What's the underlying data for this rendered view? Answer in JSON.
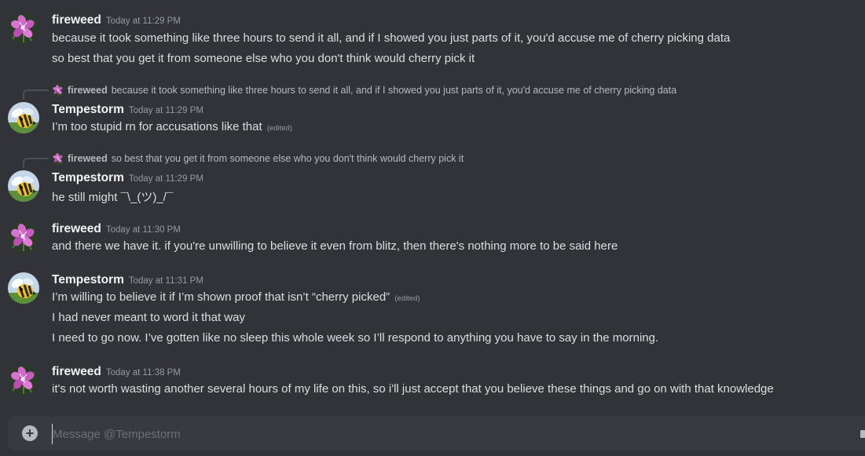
{
  "messages": [
    {
      "author": "fireweed",
      "timestamp": "Today at 11:29 PM",
      "avatar_icon": "fireweed-flower-icon",
      "lines": [
        {
          "text": "because it took something like three hours to send it all, and if I showed you just parts of it, you'd accuse me of cherry picking data"
        },
        {
          "text": "so best that you get it from someone else who you don't think would cherry pick it"
        }
      ]
    },
    {
      "author": "Tempestorm",
      "timestamp": "Today at 11:29 PM",
      "avatar_icon": "cartoon-bee-icon",
      "reply": {
        "author": "fireweed",
        "text": "because it took something like three hours to send it all, and if I showed you just parts of it, you'd accuse me of cherry picking data"
      },
      "lines": [
        {
          "text": "I’m too stupid rn for accusations like that",
          "edited": "(edited)"
        }
      ]
    },
    {
      "author": "Tempestorm",
      "timestamp": "Today at 11:29 PM",
      "avatar_icon": "cartoon-bee-icon",
      "reply": {
        "author": "fireweed",
        "text": "so best that you get it from someone else who you don't think would cherry pick it"
      },
      "lines": [
        {
          "text": "he still might ¯\\_(ツ)_/¯"
        }
      ]
    },
    {
      "author": "fireweed",
      "timestamp": "Today at 11:30 PM",
      "avatar_icon": "fireweed-flower-icon",
      "lines": [
        {
          "text": "and there we have it. if you're unwilling to believe it even from blitz, then there's nothing more to be said here"
        }
      ]
    },
    {
      "author": "Tempestorm",
      "timestamp": "Today at 11:31 PM",
      "avatar_icon": "cartoon-bee-icon",
      "lines": [
        {
          "text": "I’m willing to believe it if I’m shown proof that isn’t “cherry picked”",
          "edited": "(edited)"
        },
        {
          "text": "I had never meant to word it that way"
        },
        {
          "text": "I need to go now. I’ve gotten like no sleep this whole week so I’ll respond to anything you have to say in the morning."
        }
      ]
    },
    {
      "author": "fireweed",
      "timestamp": "Today at 11:38 PM",
      "avatar_icon": "fireweed-flower-icon",
      "lines": [
        {
          "text": "it's not worth wasting another several hours of my life on this, so i'll just accept that you believe these things and go on with that knowledge"
        }
      ]
    }
  ],
  "composer": {
    "placeholder": "Message @Tempestorm",
    "value": "",
    "attach_icon": "plus-circle-icon"
  },
  "colors": {
    "background": "#313338",
    "text": "#dbdee1",
    "muted": "#949ba4",
    "username": "#f2f3f5",
    "composer_bg": "#383a40"
  }
}
